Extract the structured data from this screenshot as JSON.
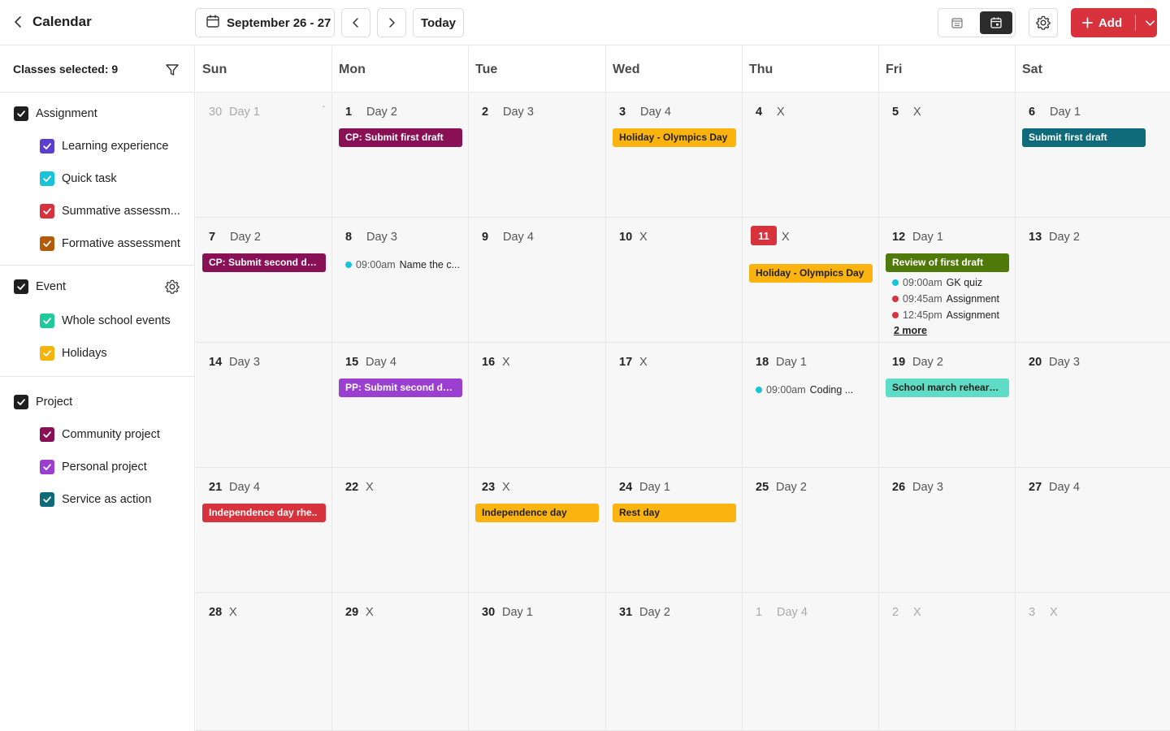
{
  "header": {
    "title": "Calendar",
    "date_range": "September 26 - 27",
    "today_label": "Today",
    "add_label": "Add"
  },
  "sidebar": {
    "classes_selected": "Classes selected: 9",
    "groups": [
      {
        "label": "Assignment",
        "children": [
          {
            "label": "Learning experience",
            "color": "#5b3fd1"
          },
          {
            "label": "Quick task",
            "color": "#19c3d8"
          },
          {
            "label": "Summative assessm...",
            "color": "#d8323c"
          },
          {
            "label": "Formative assessment",
            "color": "#b45b0a"
          }
        ]
      },
      {
        "label": "Event",
        "children": [
          {
            "label": "Whole school events",
            "color": "#1fc99a"
          },
          {
            "label": "Holidays",
            "color": "#f5b40a"
          }
        ]
      },
      {
        "label": "Project",
        "children": [
          {
            "label": "Community project",
            "color": "#8a1056"
          },
          {
            "label": "Personal project",
            "color": "#9b3fd1"
          },
          {
            "label": "Service as action",
            "color": "#0f6b7a"
          }
        ]
      }
    ]
  },
  "calendar": {
    "days_of_week": [
      "Sun",
      "Mon",
      "Tue",
      "Wed",
      "Thu",
      "Fri",
      "Sat"
    ],
    "cells": [
      {
        "num": "30",
        "label": "Day 1",
        "muted": true,
        "corner": "-"
      },
      {
        "num": "1",
        "label": "Day 2",
        "events": [
          {
            "text": "CP: Submit first draft",
            "bg": "#8a1056",
            "fg": "#ffffff"
          }
        ]
      },
      {
        "num": "2",
        "label": "Day 3"
      },
      {
        "num": "3",
        "label": "Day 4",
        "events": [
          {
            "text": "Holiday - Olympics Day",
            "bg": "#fbb40f",
            "fg": "#1f1f1f"
          }
        ]
      },
      {
        "num": "4",
        "label": "X"
      },
      {
        "num": "5",
        "label": "X"
      },
      {
        "num": "6",
        "label": "Day 1",
        "events": [
          {
            "text": "Submit first draft",
            "bg": "#0f6b7a",
            "fg": "#ffffff"
          }
        ]
      },
      {
        "num": "7",
        "label": "Day 2",
        "events": [
          {
            "text": "CP: Submit second draft",
            "bg": "#8a1056",
            "fg": "#ffffff"
          }
        ]
      },
      {
        "num": "8",
        "label": "Day 3",
        "timed": [
          {
            "time": "09:00am",
            "text": "Name the c...",
            "color": "#19c3d8"
          }
        ]
      },
      {
        "num": "9",
        "label": "Day 4"
      },
      {
        "num": "10",
        "label": "X"
      },
      {
        "num": "11",
        "label": "X",
        "today": true,
        "events": [
          {
            "text": "Holiday - Olympics Day",
            "bg": "#fbb40f",
            "fg": "#1f1f1f"
          }
        ]
      },
      {
        "num": "12",
        "label": "Day 1",
        "events": [
          {
            "text": "Review of first draft",
            "bg": "#4f7a0a",
            "fg": "#ffffff"
          }
        ],
        "timed": [
          {
            "time": "09:00am",
            "text": "GK quiz",
            "color": "#19c3d8"
          },
          {
            "time": "09:45am",
            "text": "Assignment",
            "color": "#d8323c"
          },
          {
            "time": "12:45pm",
            "text": "Assignment",
            "color": "#d8323c"
          }
        ],
        "more": "2 more"
      },
      {
        "num": "13",
        "label": "Day 2"
      },
      {
        "num": "14",
        "label": "Day 3"
      },
      {
        "num": "15",
        "label": "Day 4",
        "events": [
          {
            "text": "PP: Submit second draft",
            "bg": "#9b3fd1",
            "fg": "#ffffff"
          }
        ]
      },
      {
        "num": "16",
        "label": "X"
      },
      {
        "num": "17",
        "label": "X"
      },
      {
        "num": "18",
        "label": "Day 1",
        "timed": [
          {
            "time": "09:00am",
            "text": "Coding ...",
            "color": "#19c3d8"
          }
        ]
      },
      {
        "num": "19",
        "label": "Day 2",
        "events": [
          {
            "text": "School march rehearsal",
            "bg": "#5fdcc5",
            "fg": "#1f1f1f"
          }
        ]
      },
      {
        "num": "20",
        "label": "Day 3"
      },
      {
        "num": "21",
        "label": "Day 4",
        "events": [
          {
            "text": "Independence day rhe..",
            "bg": "#d8323c",
            "fg": "#ffffff"
          }
        ]
      },
      {
        "num": "22",
        "label": "X"
      },
      {
        "num": "23",
        "label": "X",
        "events": [
          {
            "text": "Independence day",
            "bg": "#fbb40f",
            "fg": "#1f1f1f"
          }
        ]
      },
      {
        "num": "24",
        "label": "Day 1",
        "events": [
          {
            "text": "Rest day",
            "bg": "#fbb40f",
            "fg": "#1f1f1f"
          }
        ]
      },
      {
        "num": "25",
        "label": "Day 2"
      },
      {
        "num": "26",
        "label": "Day 3"
      },
      {
        "num": "27",
        "label": "Day 4"
      },
      {
        "num": "28",
        "label": "X"
      },
      {
        "num": "29",
        "label": "X"
      },
      {
        "num": "30",
        "label": "Day  1"
      },
      {
        "num": "31",
        "label": "Day 2"
      },
      {
        "num": "1",
        "label": "Day 4",
        "muted": true
      },
      {
        "num": "2",
        "label": "X",
        "muted": true
      },
      {
        "num": "3",
        "label": "X",
        "muted": true
      }
    ]
  }
}
